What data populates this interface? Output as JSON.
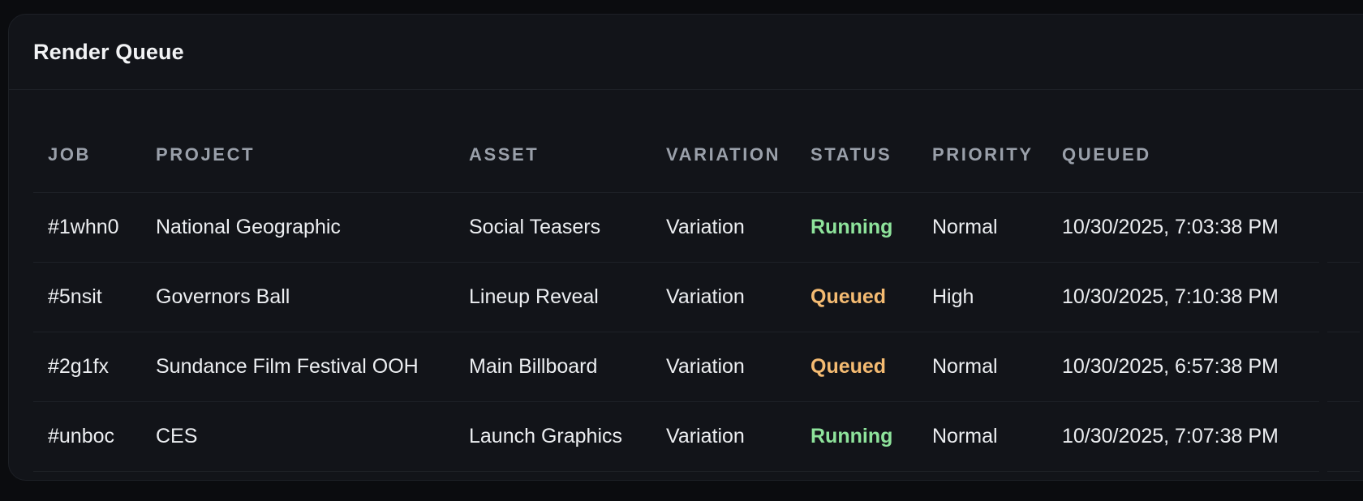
{
  "panel": {
    "title": "Render Queue"
  },
  "columns": {
    "job": "JOB",
    "project": "PROJECT",
    "asset": "ASSET",
    "variation": "VARIATION",
    "status": "STATUS",
    "priority": "PRIORITY",
    "queued": "QUEUED"
  },
  "rows": [
    {
      "job": "#1whn0",
      "project": "National Geographic",
      "asset": "Social Teasers",
      "variation": "Variation",
      "status": "Running",
      "priority": "Normal",
      "queued": "10/30/2025, 7:03:38 PM"
    },
    {
      "job": "#5nsit",
      "project": "Governors Ball",
      "asset": "Lineup Reveal",
      "variation": "Variation",
      "status": "Queued",
      "priority": "High",
      "queued": "10/30/2025, 7:10:38 PM"
    },
    {
      "job": "#2g1fx",
      "project": "Sundance Film Festival OOH",
      "asset": "Main Billboard",
      "variation": "Variation",
      "status": "Queued",
      "priority": "Normal",
      "queued": "10/30/2025, 6:57:38 PM"
    },
    {
      "job": "#unboc",
      "project": "CES",
      "asset": "Launch Graphics",
      "variation": "Variation",
      "status": "Running",
      "priority": "Normal",
      "queued": "10/30/2025, 7:07:38 PM"
    }
  ],
  "colors": {
    "running": "#8ee39b",
    "queued": "#f4bb72",
    "background": "#0b0c0f",
    "panel": "#121419"
  }
}
